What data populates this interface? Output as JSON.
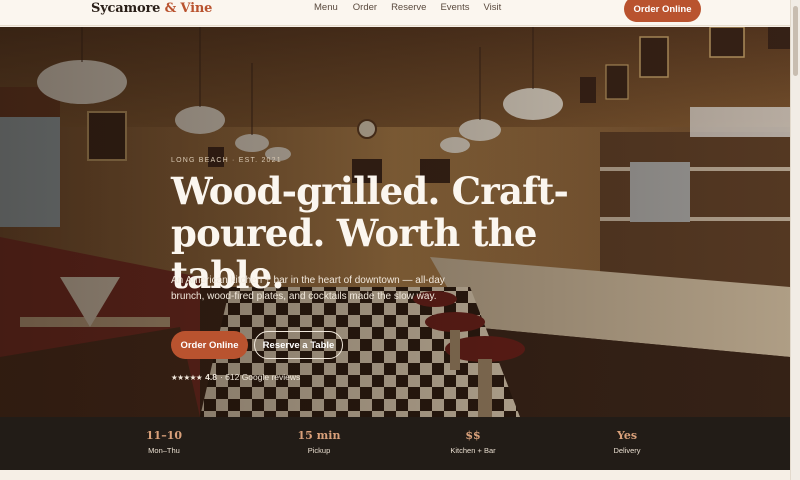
{
  "header": {
    "logo_main": "Sycamore",
    "logo_amp": "& Vine",
    "nav": [
      "Menu",
      "Order",
      "Reserve",
      "Events",
      "Visit"
    ],
    "cta": "Order Online"
  },
  "hero": {
    "eyebrow": "LONG BEACH · EST. 2021",
    "headline_line1": "Wood-grilled. Craft-",
    "headline_line2": "poured. Worth the table.",
    "subcopy": "An American kitchen + bar in the heart of downtown — all-day brunch, wood-fired plates, and cocktails made the slow way.",
    "primary_button": "Order Online",
    "secondary_button": "Reserve a Table",
    "rating": {
      "stars": "★★★★★",
      "score": "4.8",
      "reviews": "· 612 Google reviews",
      "value": 4.8
    }
  },
  "stats": [
    {
      "value": "11–10",
      "label": "Mon–Thu"
    },
    {
      "value": "15 min",
      "label": "Pickup"
    },
    {
      "value": "$$",
      "label": "Kitchen + Bar"
    },
    {
      "value": "Yes",
      "label": "Delivery"
    }
  ],
  "colors": {
    "accent": "#b9532f",
    "header_bg": "#fbf6ef",
    "stats_bg": "#221c17",
    "stats_value": "#d9a07a"
  }
}
